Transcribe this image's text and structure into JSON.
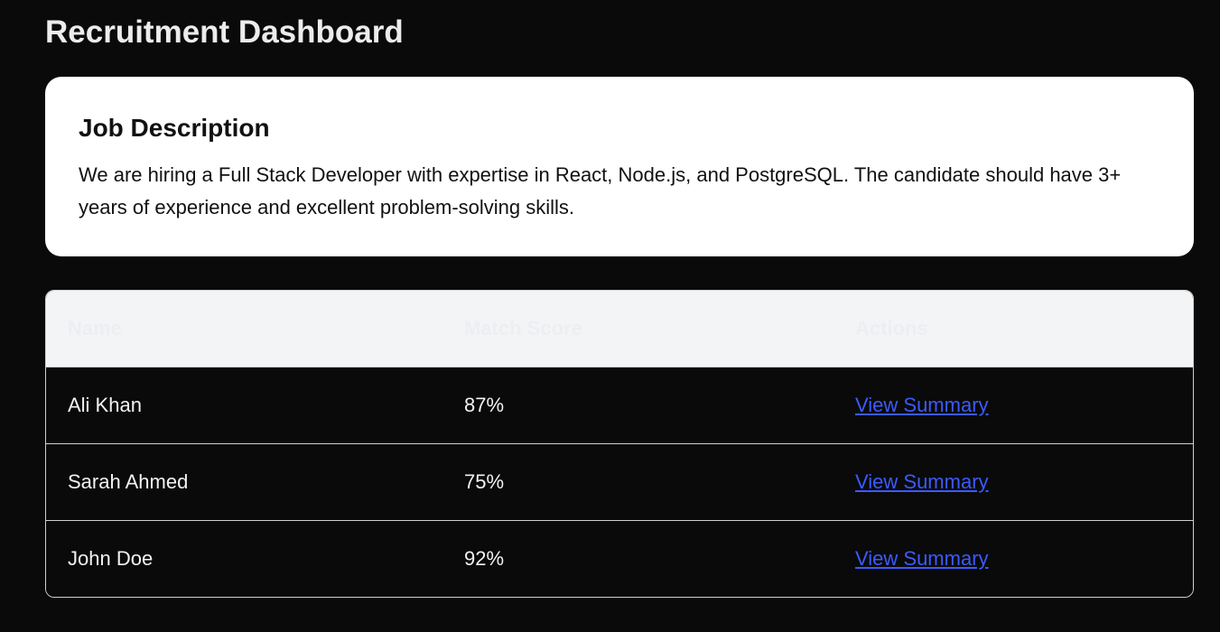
{
  "page": {
    "title": "Recruitment Dashboard"
  },
  "job": {
    "heading": "Job Description",
    "description": "We are hiring a Full Stack Developer with expertise in React, Node.js, and PostgreSQL. The candidate should have 3+ years of experience and excellent problem-solving skills."
  },
  "table": {
    "headers": [
      "Name",
      "Match Score",
      "Actions"
    ],
    "rows": [
      {
        "name": "Ali Khan",
        "score": "87%",
        "action": "View Summary"
      },
      {
        "name": "Sarah Ahmed",
        "score": "75%",
        "action": "View Summary"
      },
      {
        "name": "John Doe",
        "score": "92%",
        "action": "View Summary"
      }
    ]
  },
  "colors": {
    "background": "#0a0a0a",
    "card": "#ffffff",
    "link": "#3b5bff",
    "header_row": "#f3f4f6"
  }
}
